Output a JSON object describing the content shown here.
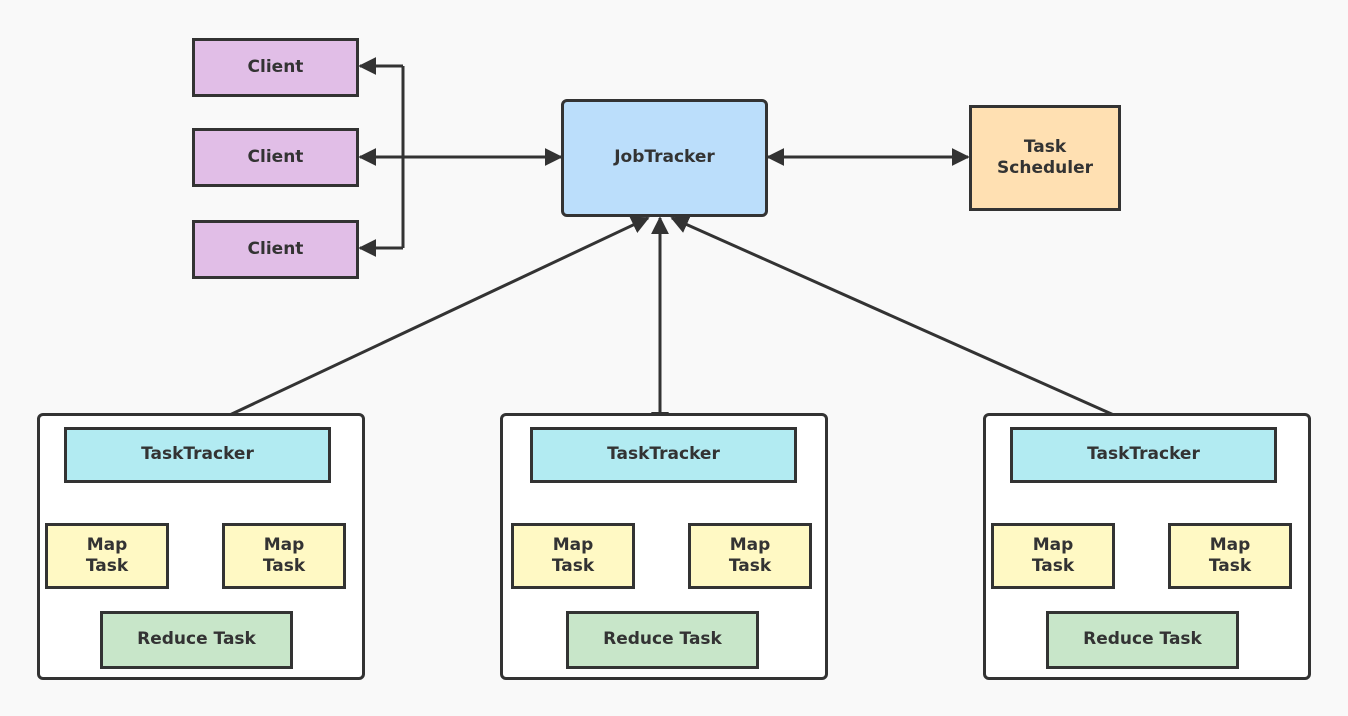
{
  "colors": {
    "client": "#e1bee7",
    "jobtracker": "#bbdefb",
    "scheduler": "#ffe0b2",
    "tasktracker": "#b2ebf2",
    "map": "#fff9c4",
    "reduce": "#c8e6c9",
    "stroke": "#333333",
    "background": "#f9f9f9"
  },
  "clients": [
    {
      "label": "Client"
    },
    {
      "label": "Client"
    },
    {
      "label": "Client"
    }
  ],
  "jobtracker": {
    "label": "JobTracker"
  },
  "scheduler": {
    "label": "Task\nScheduler"
  },
  "nodes": [
    {
      "tasktracker": "TaskTracker",
      "map1": "Map\nTask",
      "map2": "Map\nTask",
      "reduce": "Reduce Task"
    },
    {
      "tasktracker": "TaskTracker",
      "map1": "Map\nTask",
      "map2": "Map\nTask",
      "reduce": "Reduce Task"
    },
    {
      "tasktracker": "TaskTracker",
      "map1": "Map\nTask",
      "map2": "Map\nTask",
      "reduce": "Reduce Task"
    }
  ],
  "edges": [
    {
      "from": "jobtracker",
      "to": "clients",
      "direction": "bidirectional"
    },
    {
      "from": "jobtracker",
      "to": "scheduler",
      "direction": "bidirectional"
    },
    {
      "from": "jobtracker",
      "to": "tasktracker-1",
      "direction": "bidirectional"
    },
    {
      "from": "jobtracker",
      "to": "tasktracker-2",
      "direction": "bidirectional"
    },
    {
      "from": "jobtracker",
      "to": "tasktracker-3",
      "direction": "bidirectional"
    },
    {
      "from": "tasktracker",
      "to": "map-task",
      "direction": "bidirectional"
    },
    {
      "from": "tasktracker",
      "to": "reduce-task",
      "direction": "bidirectional"
    }
  ]
}
